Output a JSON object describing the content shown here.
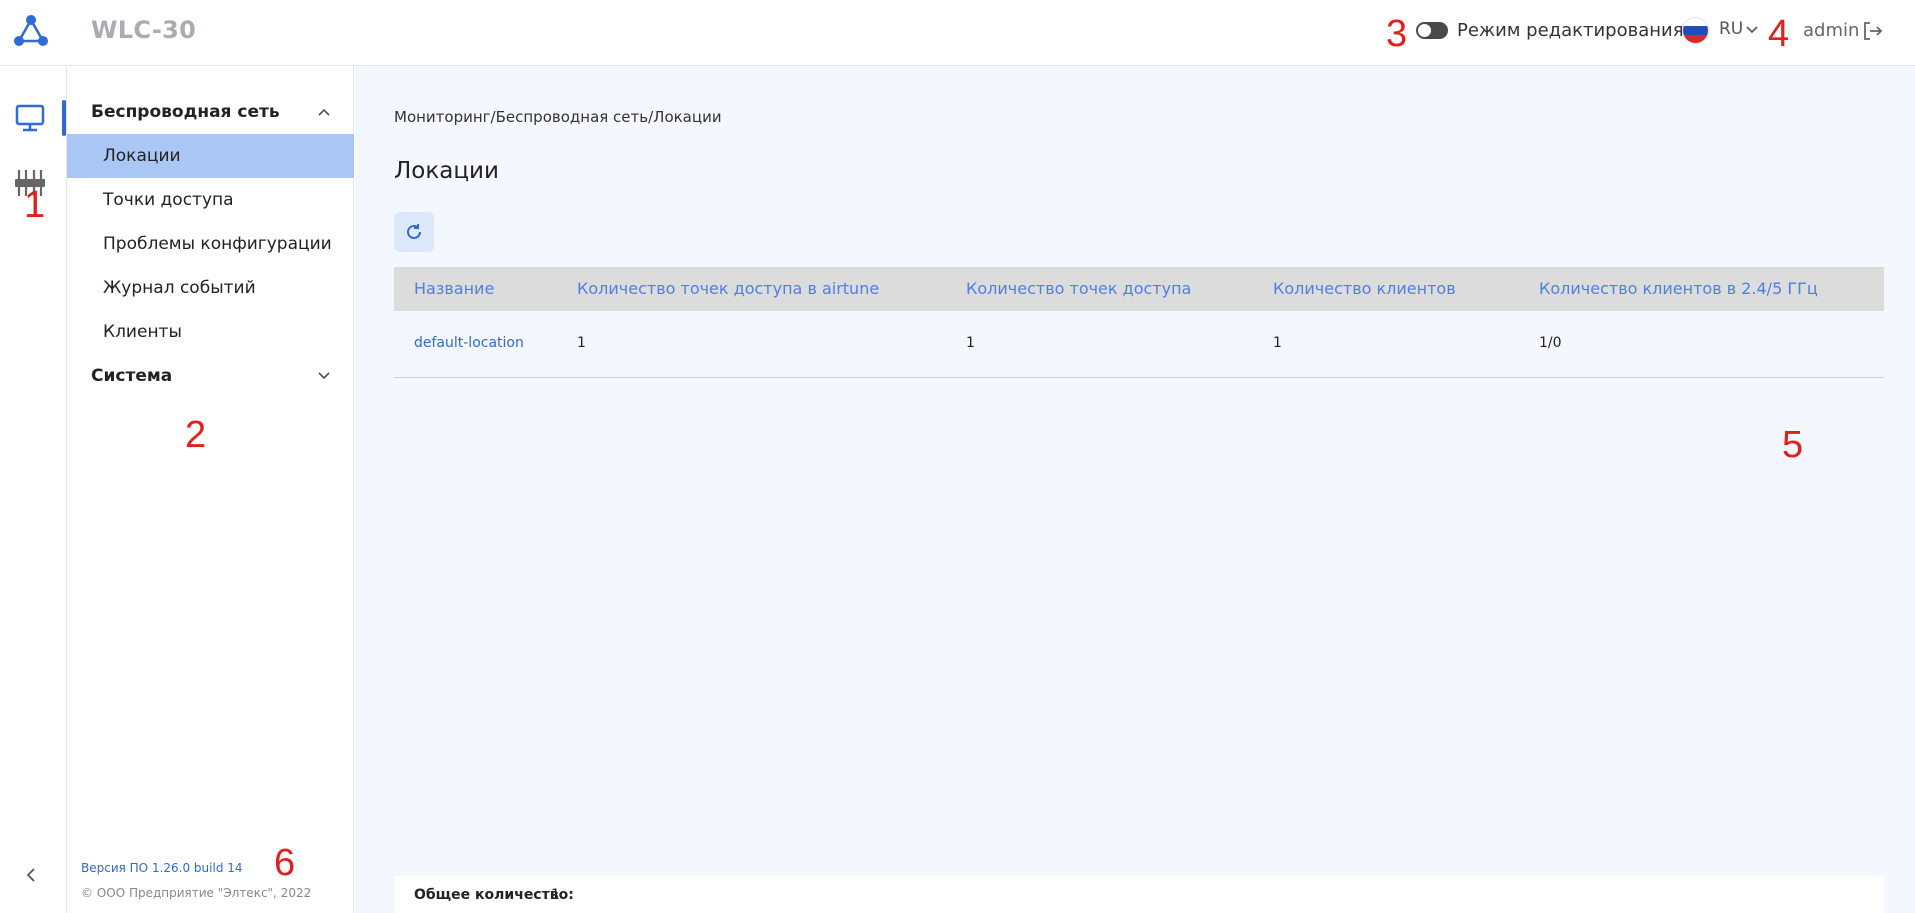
{
  "header": {
    "app_title": "WLC-30",
    "edit_mode_label": "Режим редактирования",
    "language": "RU",
    "user": "admin"
  },
  "annotations": [
    "1",
    "2",
    "3",
    "4",
    "5",
    "6"
  ],
  "sidebar": {
    "groups": [
      {
        "label": "Беспроводная сеть",
        "expanded": true,
        "items": [
          {
            "label": "Локации",
            "active": true
          },
          {
            "label": "Точки доступа"
          },
          {
            "label": "Проблемы конфигурации"
          },
          {
            "label": "Журнал событий"
          },
          {
            "label": "Клиенты"
          }
        ]
      },
      {
        "label": "Система",
        "expanded": false
      }
    ],
    "footer": {
      "version": "Версия ПО 1.26.0 build 14",
      "copyright": "© ООО Предприятие \"Элтекс\", 2022"
    }
  },
  "main": {
    "breadcrumb": "Мониторинг/Беспроводная сеть/Локации",
    "title": "Локации",
    "table": {
      "columns": [
        "Название",
        "Количество точек доступа в airtune",
        "Количество точек доступа",
        "Количество клиентов",
        "Количество клиентов в 2.4/5 ГГц"
      ],
      "rows": [
        [
          "default-location",
          "1",
          "1",
          "1",
          "1/0"
        ]
      ]
    },
    "total_label": "Общее количество:",
    "total_value": "1"
  },
  "colors": {
    "accent": "#2f6bd4",
    "active_item": "#a9c6f5",
    "header_link": "#4f7ee6",
    "annotation": "#e0201c"
  }
}
